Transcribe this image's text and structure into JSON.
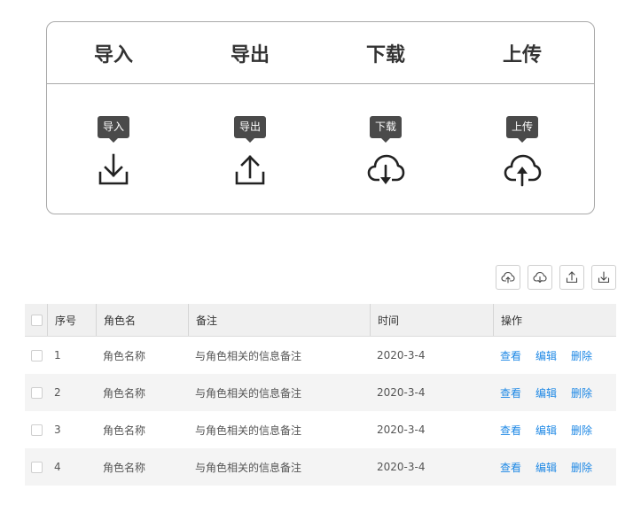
{
  "card": {
    "headers": [
      "导入",
      "导出",
      "下载",
      "上传"
    ],
    "tooltips": [
      "导入",
      "导出",
      "下载",
      "上传"
    ],
    "icons": [
      "import-icon",
      "export-icon",
      "cloud-download-icon",
      "cloud-upload-icon"
    ]
  },
  "toolbar": {
    "icons": [
      "cloud-upload-icon",
      "cloud-download-icon",
      "export-icon",
      "import-icon"
    ]
  },
  "table": {
    "columns": [
      "序号",
      "角色名",
      "备注",
      "时间",
      "操作"
    ],
    "rows": [
      {
        "index": "1",
        "name": "角色名称",
        "note": "与角色相关的信息备注",
        "time": "2020-3-4",
        "ops": [
          "查看",
          "编辑",
          "删除"
        ]
      },
      {
        "index": "2",
        "name": "角色名称",
        "note": "与角色相关的信息备注",
        "time": "2020-3-4",
        "ops": [
          "查看",
          "编辑",
          "删除"
        ]
      },
      {
        "index": "3",
        "name": "角色名称",
        "note": "与角色相关的信息备注",
        "time": "2020-3-4",
        "ops": [
          "查看",
          "编辑",
          "删除"
        ]
      },
      {
        "index": "4",
        "name": "角色名称",
        "note": "与角色相关的信息备注",
        "time": "2020-3-4",
        "ops": [
          "查看",
          "编辑",
          "删除"
        ]
      }
    ]
  },
  "colors": {
    "link": "#1e88e5",
    "tooltip_bg": "#4a4a4a",
    "header_bg": "#f0f0f0",
    "stripe_bg": "#f4f4f4"
  }
}
